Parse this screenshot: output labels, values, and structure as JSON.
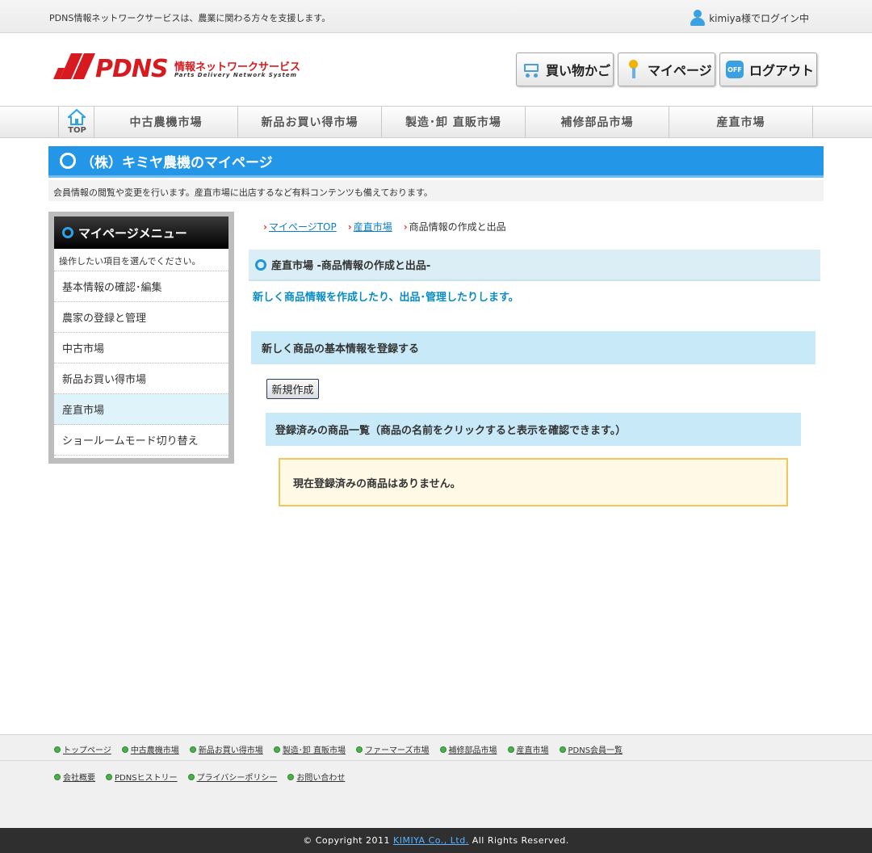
{
  "topbar": {
    "tagline": "PDNS情報ネットワークサービスは、農業に関わる方々を支援します。",
    "login_status": "kimiya様でログイン中"
  },
  "logo": {
    "brand": "PDNS",
    "jp_name": "情報ネットワークサービス",
    "en_name": "Parts Delivery Network System"
  },
  "header_buttons": {
    "cart": "買い物かご",
    "mypage": "マイページ",
    "logout": "ログアウト",
    "off_badge": "OFF"
  },
  "gnav": {
    "top": "TOP",
    "items": [
      "中古農機市場",
      "新品お買い得市場",
      "製造･卸 直販市場",
      "補修部品市場",
      "産直市場"
    ]
  },
  "page": {
    "title": "（株）キミヤ農機のマイページ",
    "description": "会員情報の閲覧や変更を行います。産直市場に出店するなど有料コンテンツも備えております。"
  },
  "sidebar": {
    "title": "マイページメニュー",
    "note": "操作したい項目を選んでください。",
    "items": [
      {
        "label": "基本情報の確認･編集"
      },
      {
        "label": "農家の登録と管理"
      },
      {
        "label": "中古市場"
      },
      {
        "label": "新品お買い得市場"
      },
      {
        "label": "産直市場"
      },
      {
        "label": "ショールームモード切り替え"
      }
    ],
    "active_index": 4
  },
  "breadcrumb": {
    "items": [
      "マイページTOP",
      "産直市場",
      "商品情報の作成と出品"
    ]
  },
  "main": {
    "section_title": "産直市場 -商品情報の作成と出品-",
    "lead": "新しく商品情報を作成したり、出品･管理したりします。",
    "register_heading": "新しく商品の基本情報を登録する",
    "new_button": "新規作成",
    "list_heading": "登録済みの商品一覧（商品の名前をクリックすると表示を確認できます。）",
    "empty_message": "現在登録済みの商品はありません。"
  },
  "footer": {
    "row1": [
      "トップページ",
      "中古農機市場",
      "新品お買い得市場",
      "製造･卸 直販市場",
      "ファーマーズ市場",
      "補修部品市場",
      "産直市場",
      "PDNS会員一覧"
    ],
    "row2": [
      "会社概要",
      "PDNSヒストリー",
      "プライバシーポリシー",
      "お問い合わせ"
    ],
    "copyright_prefix": "© Copyright 2011",
    "company_link": "KIMIYA Co., Ltd.",
    "copyright_suffix": "All Rights Reserved."
  },
  "colors": {
    "accent_blue": "#2396e8",
    "brand_red": "#d71920",
    "section_bg": "#c8eaf8",
    "notice_border": "#f2c65a"
  }
}
